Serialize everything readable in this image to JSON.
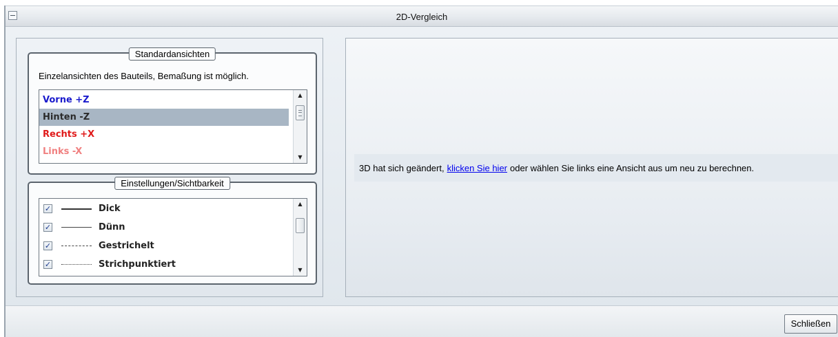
{
  "window": {
    "title": "2D-Vergleich"
  },
  "standard_views": {
    "legend": "Standardansichten",
    "description": "Einzelansichten des Bauteils, Bemaßung ist möglich.",
    "items": [
      {
        "label": "Vorne +Z",
        "color": "#1a1acc",
        "selected": false
      },
      {
        "label": "Hinten -Z",
        "color": "#2b2b2b",
        "selected": true
      },
      {
        "label": "Rechts +X",
        "color": "#e01a1a",
        "selected": false
      },
      {
        "label": "Links -X",
        "color": "#f08080",
        "selected": false
      }
    ],
    "selection_color": "#a8b6c4"
  },
  "settings": {
    "legend": "Einstellungen/Sichtbarkeit",
    "items": [
      {
        "label": "Dick",
        "checked": true,
        "line_style": "solid-thick"
      },
      {
        "label": "Dünn",
        "checked": true,
        "line_style": "solid-thin"
      },
      {
        "label": "Gestrichelt",
        "checked": true,
        "line_style": "dashed"
      },
      {
        "label": "Strichpunktiert",
        "checked": true,
        "line_style": "dash-dot"
      }
    ]
  },
  "preview": {
    "message_before": "3D hat sich geändert,",
    "link": "klicken Sie hier",
    "message_after": "oder wählen Sie links eine Ansicht aus um neu zu berechnen."
  },
  "footer": {
    "close_label": "Schließen"
  },
  "icons": {
    "collapse": "collapse-icon",
    "scroll_up": "scroll-up-icon",
    "scroll_down": "scroll-down-icon",
    "check": "checkmark-icon"
  }
}
